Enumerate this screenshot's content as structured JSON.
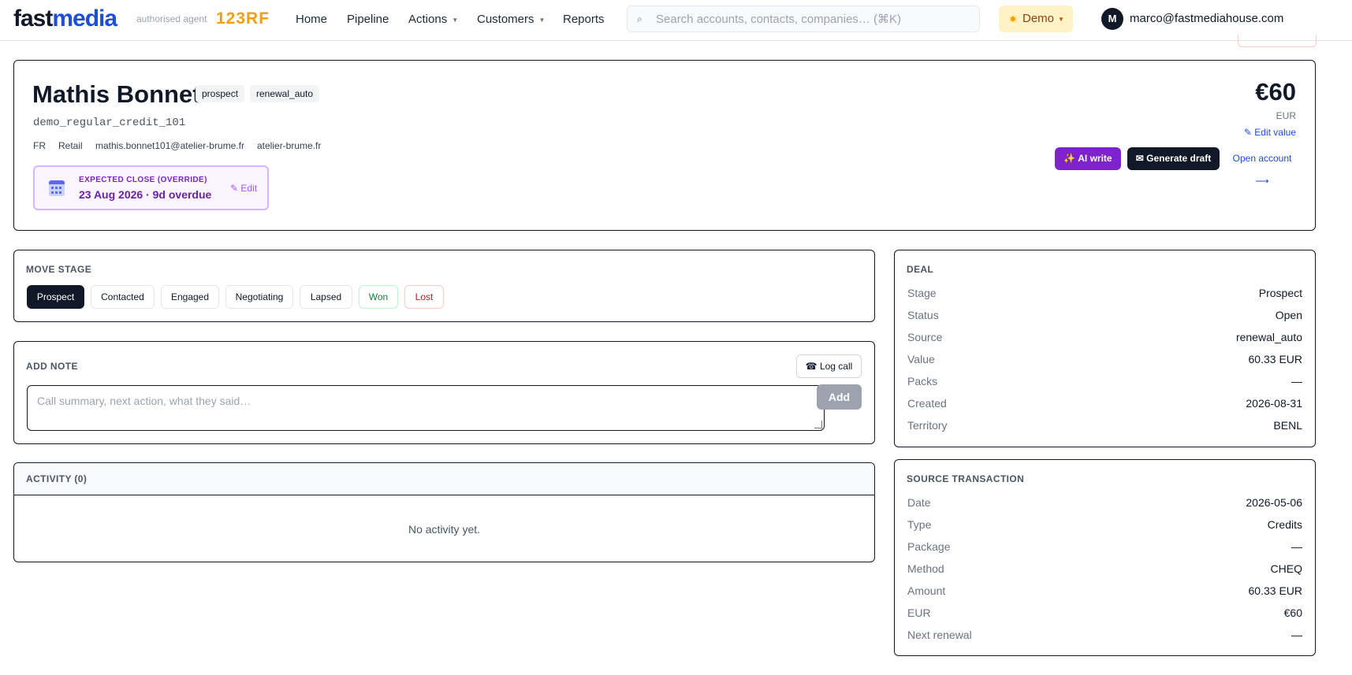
{
  "header": {
    "brand_part1": "fast",
    "brand_part2": "media",
    "agent_text": "authorised agent",
    "partner_logo": "123RF",
    "nav": [
      {
        "label": "Home"
      },
      {
        "label": "Pipeline"
      },
      {
        "label": "Actions",
        "has_dropdown": true
      },
      {
        "label": "Customers",
        "has_dropdown": true
      },
      {
        "label": "Reports"
      }
    ],
    "search_placeholder": "Search accounts, contacts, companies… (⌘K)",
    "search_icon": "search-icon",
    "env_label": "Demo",
    "avatar_initial": "M",
    "user_email": "marco@fastmediahouse.com"
  },
  "deal_header": {
    "name": "Mathis Bonnet",
    "tags": [
      "prospect",
      "renewal_auto"
    ],
    "handle": "demo_regular_credit_101",
    "country": "FR",
    "segment": "Retail",
    "email": "mathis.bonnet101@atelier-brume.fr",
    "website": "atelier-brume.fr",
    "close_label": "EXPECTED CLOSE (OVERRIDE)",
    "close_value": "23 Aug 2026 · 9d overdue",
    "close_edit": "✎ Edit",
    "price": "€60",
    "currency": "EUR",
    "edit_value": "✎ Edit value",
    "ai_write": "✨ AI write",
    "generate_draft": "✉ Generate draft",
    "open_account": "Open account ⟶"
  },
  "move_stage": {
    "title": "MOVE STAGE",
    "active": "Prospect",
    "stages": [
      "Prospect",
      "Contacted",
      "Engaged",
      "Negotiating",
      "Lapsed",
      "Won",
      "Lost"
    ]
  },
  "add_note": {
    "title": "ADD NOTE",
    "log_call": "☎ Log call",
    "placeholder": "Call summary, next action, what they said…",
    "add": "Add"
  },
  "activity": {
    "title": "ACTIVITY (0)",
    "empty": "No activity yet."
  },
  "deal": {
    "title": "DEAL",
    "rows": [
      {
        "key": "Stage",
        "value": "Prospect"
      },
      {
        "key": "Status",
        "value": "Open"
      },
      {
        "key": "Source",
        "value": "renewal_auto"
      },
      {
        "key": "Value",
        "value": "60.33 EUR"
      },
      {
        "key": "Packs",
        "value": "—"
      },
      {
        "key": "Created",
        "value": "2026-08-31"
      },
      {
        "key": "Territory",
        "value": "BENL"
      }
    ]
  },
  "source_transaction": {
    "title": "SOURCE TRANSACTION",
    "rows": [
      {
        "key": "Date",
        "value": "2026-05-06"
      },
      {
        "key": "Type",
        "value": "Credits"
      },
      {
        "key": "Package",
        "value": "—"
      },
      {
        "key": "Method",
        "value": "CHEQ"
      },
      {
        "key": "Amount",
        "value": "60.33 EUR"
      },
      {
        "key": "EUR",
        "value": "€60"
      },
      {
        "key": "Next renewal",
        "value": "—"
      }
    ]
  },
  "colors": {
    "brand_blue": "#1d4ed8",
    "ai_purple": "#7e22ce",
    "dark": "#111827",
    "won_green": "#15803d",
    "lost_red": "#b91c1c"
  }
}
